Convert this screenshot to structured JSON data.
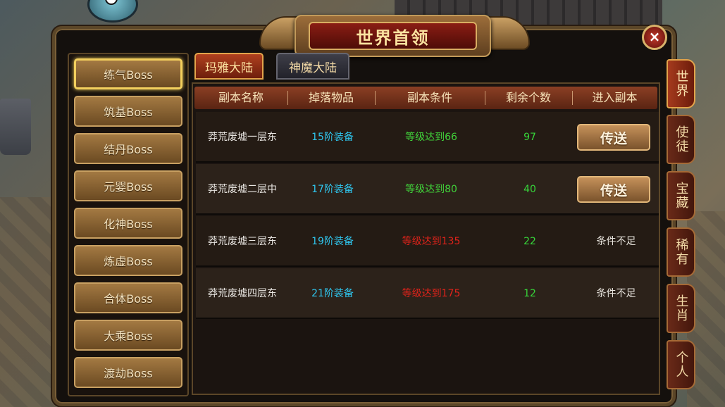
{
  "window": {
    "title": "世界首领",
    "close_icon": "×"
  },
  "sidebar": {
    "items": [
      {
        "label": "练气Boss",
        "active": true
      },
      {
        "label": "筑基Boss",
        "active": false
      },
      {
        "label": "结丹Boss",
        "active": false
      },
      {
        "label": "元婴Boss",
        "active": false
      },
      {
        "label": "化神Boss",
        "active": false
      },
      {
        "label": "炼虚Boss",
        "active": false
      },
      {
        "label": "合体Boss",
        "active": false
      },
      {
        "label": "大乘Boss",
        "active": false
      },
      {
        "label": "渡劫Boss",
        "active": false
      }
    ]
  },
  "tabs": [
    {
      "label": "玛雅大陆",
      "active": true
    },
    {
      "label": "神魔大陆",
      "active": false
    }
  ],
  "table": {
    "headers": [
      "副本名称",
      "掉落物品",
      "副本条件",
      "剩余个数",
      "进入副本"
    ],
    "rows": [
      {
        "name": "莽荒废墟一层东",
        "drop": "15阶装备",
        "condition": "等级达到66",
        "condition_met": true,
        "count": "97",
        "action": "传送",
        "action_type": "button"
      },
      {
        "name": "莽荒废墟二层中",
        "drop": "17阶装备",
        "condition": "等级达到80",
        "condition_met": true,
        "count": "40",
        "action": "传送",
        "action_type": "button"
      },
      {
        "name": "莽荒废墟三层东",
        "drop": "19阶装备",
        "condition": "等级达到135",
        "condition_met": false,
        "count": "22",
        "action": "条件不足",
        "action_type": "text"
      },
      {
        "name": "莽荒废墟四层东",
        "drop": "21阶装备",
        "condition": "等级达到175",
        "condition_met": false,
        "count": "12",
        "action": "条件不足",
        "action_type": "text"
      }
    ]
  },
  "right_tabs": [
    {
      "label": "世界",
      "active": true
    },
    {
      "label": "使徒",
      "active": false
    },
    {
      "label": "宝藏",
      "active": false
    },
    {
      "label": "稀有",
      "active": false
    },
    {
      "label": "生肖",
      "active": false
    },
    {
      "label": "个人",
      "active": false
    }
  ],
  "colors": {
    "drop": "#2fc6ee",
    "condition_met": "#41d33a",
    "condition_unmet": "#e2231a",
    "count": "#37d63a"
  }
}
